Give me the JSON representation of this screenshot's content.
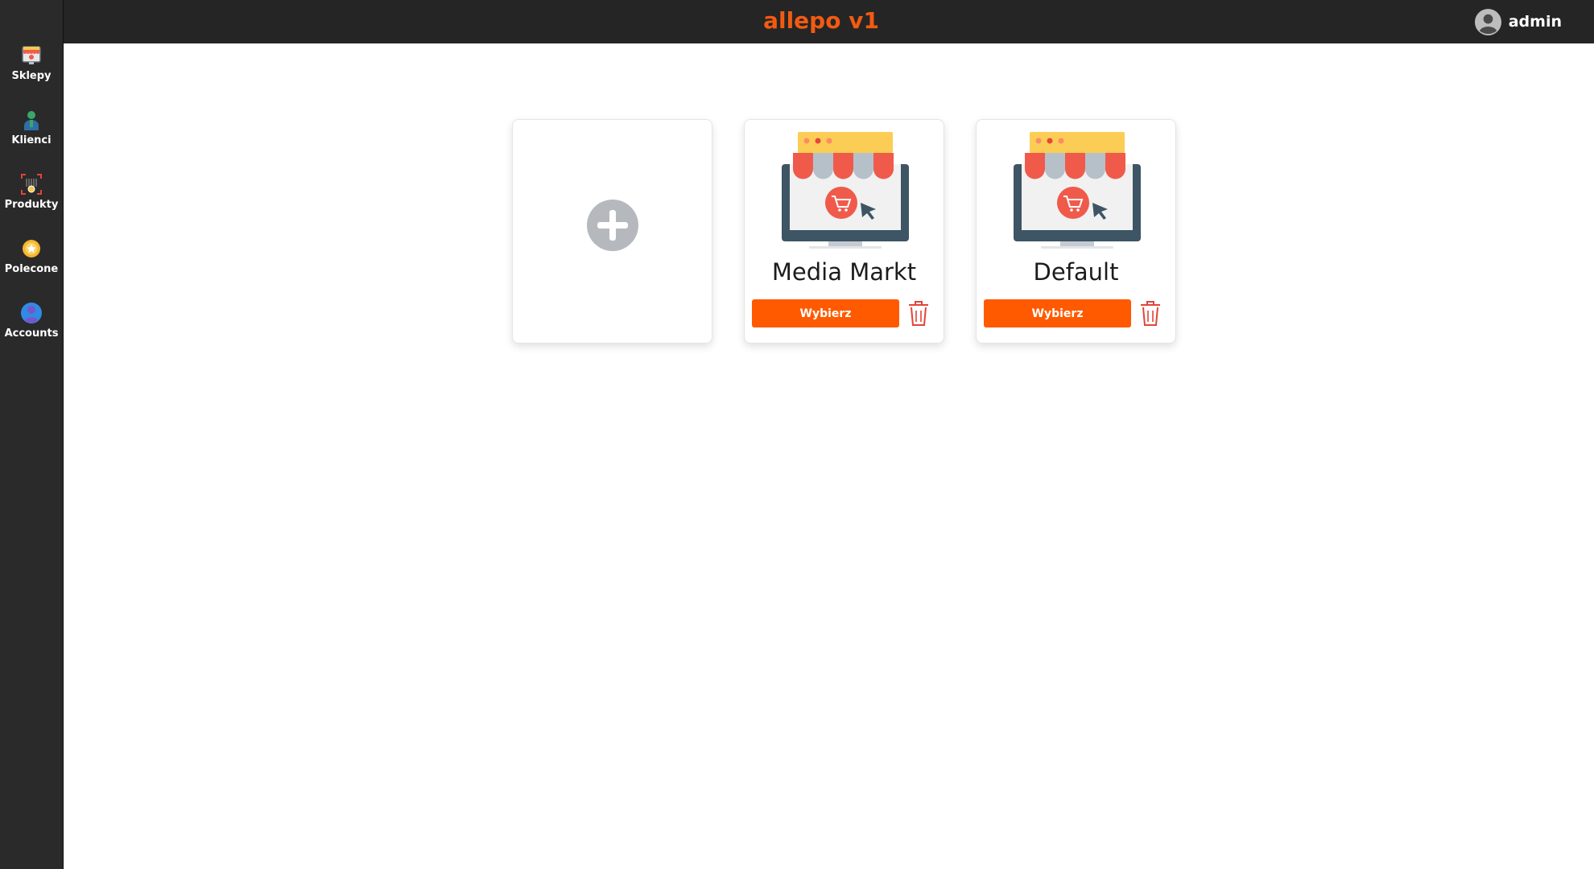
{
  "app": {
    "title": "allepo v1"
  },
  "user": {
    "name": "admin",
    "icon": "user-avatar-icon"
  },
  "sidebar": {
    "items": [
      {
        "label": "Sklepy",
        "icon": "shop-icon"
      },
      {
        "label": "Klienci",
        "icon": "client-icon"
      },
      {
        "label": "Produkty",
        "icon": "product-icon"
      },
      {
        "label": "Polecone",
        "icon": "star-badge-icon"
      },
      {
        "label": "Accounts",
        "icon": "account-icon"
      }
    ]
  },
  "main": {
    "add_card": {
      "icon": "plus-circle-icon"
    },
    "shops": [
      {
        "name": "Media Markt",
        "select_label": "Wybierz",
        "delete_icon": "trash-icon"
      },
      {
        "name": "Default",
        "select_label": "Wybierz",
        "delete_icon": "trash-icon"
      }
    ]
  },
  "colors": {
    "brand": "#f25a12",
    "button": "#ff5a00",
    "sidebar_bg": "#2a2a2a",
    "topbar_bg": "#252525",
    "trash": "#e0453a"
  }
}
